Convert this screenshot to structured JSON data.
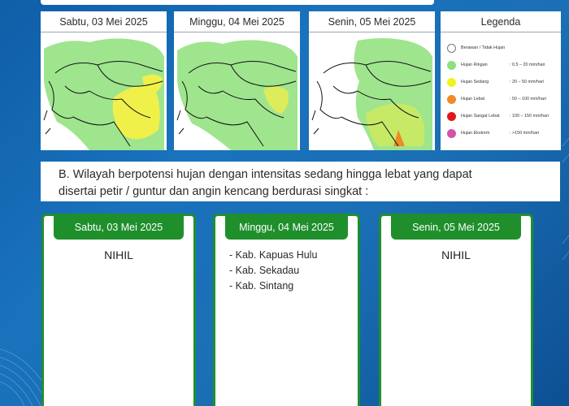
{
  "maps": [
    {
      "date": "Sabtu, 03 Mei 2025"
    },
    {
      "date": "Minggu, 04 Mei 2025"
    },
    {
      "date": "Senin, 05 Mei 2025"
    }
  ],
  "legend": {
    "title": "Legenda",
    "items": [
      {
        "name": "Berawan / Tidak Hujan",
        "range": "",
        "color": "#ffffff"
      },
      {
        "name": "Hujan Ringan",
        "range": ": 0.5 – 20 mm/hari",
        "color": "#8ee07f"
      },
      {
        "name": "Hujan Sedang",
        "range": ": 20 – 50 mm/hari",
        "color": "#f2f21c"
      },
      {
        "name": "Hujan Lebat",
        "range": ": 50 – 100 mm/hari",
        "color": "#ef8a26"
      },
      {
        "name": "Hujan Sangat Lebat",
        "range": ": 100 – 150 mm/hari",
        "color": "#e0161c"
      },
      {
        "name": "Hujan Ekstrem",
        "range": ": >150 mm/hari",
        "color": "#d652a9"
      }
    ]
  },
  "section_b": {
    "line1": "B. Wilayah berpotensi hujan dengan intensitas sedang hingga lebat yang dapat",
    "line2": "disertai petir / guntur dan angin kencang berdurasi singkat :"
  },
  "days": [
    {
      "date": "Sabtu, 03 Mei 2025",
      "nihil": "NIHIL"
    },
    {
      "date": "Minggu, 04 Mei 2025",
      "regions": [
        "- Kab. Kapuas Hulu",
        "- Kab. Sekadau",
        "- Kab. Sintang"
      ]
    },
    {
      "date": "Senin, 05 Mei 2025",
      "nihil": "NIHIL"
    }
  ]
}
